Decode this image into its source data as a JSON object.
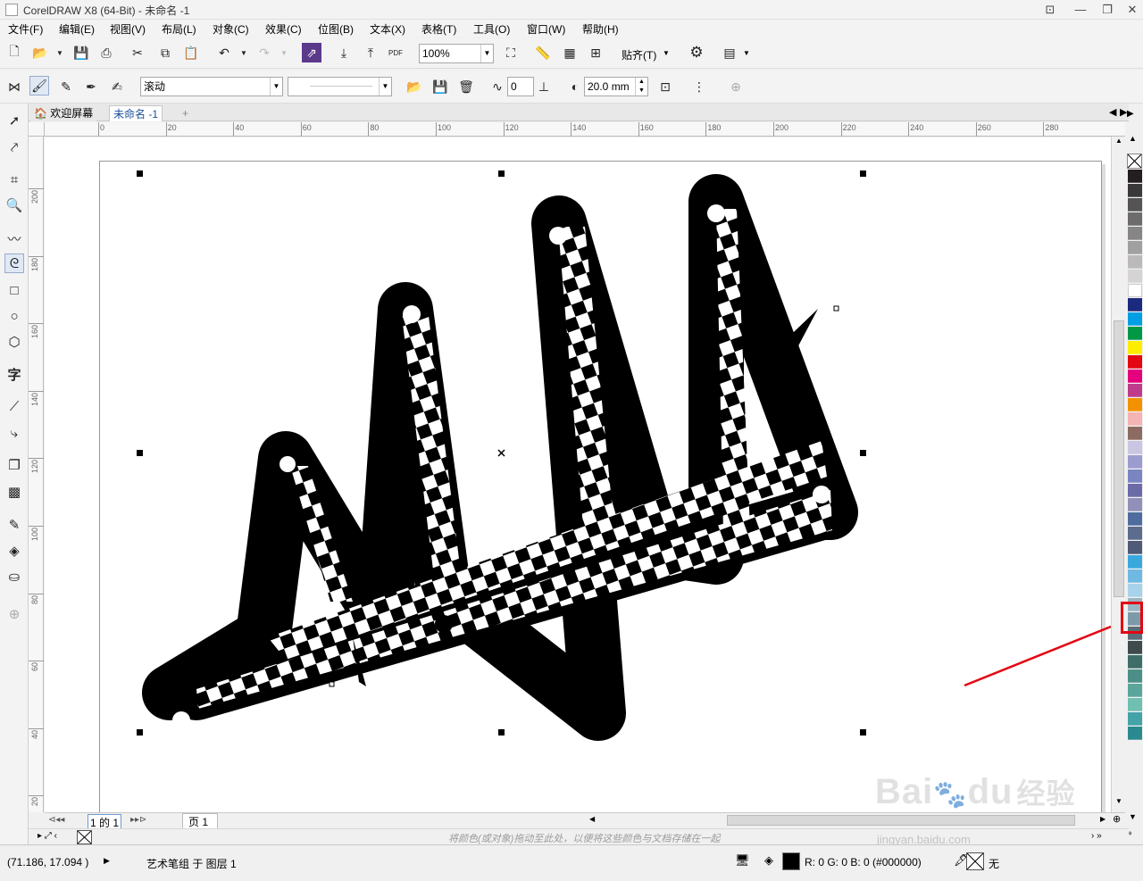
{
  "window": {
    "title": "CorelDRAW X8 (64-Bit) - 未命名 -1"
  },
  "menu": [
    "文件(F)",
    "编辑(E)",
    "视图(V)",
    "布局(L)",
    "对象(C)",
    "效果(C)",
    "位图(B)",
    "文本(X)",
    "表格(T)",
    "工具(O)",
    "窗口(W)",
    "帮助(H)"
  ],
  "standard_toolbar": {
    "zoom": "100%",
    "snap_label": "贴齐(T)",
    "pdf_label": "PDF"
  },
  "property_bar": {
    "brush_type": "滚动",
    "stroke_preset": "",
    "smoothing": "0",
    "width": "20.0 mm"
  },
  "tabs": {
    "welcome": "欢迎屏幕",
    "document": "未命名 -1"
  },
  "ruler": {
    "h_ticks": [
      "0",
      "20",
      "40",
      "60",
      "80",
      "100",
      "120",
      "140",
      "160",
      "180",
      "200",
      "220",
      "240",
      "260",
      "280"
    ],
    "v_ticks": [
      "200",
      "180",
      "160",
      "140",
      "120",
      "100",
      "80",
      "60",
      "40",
      "20"
    ]
  },
  "page_nav": {
    "current": "1",
    "of": "的",
    "total": "1",
    "page_tab": "页 1"
  },
  "doc_palette_hint": "将颜色(或对象)拖动至此处，以便将这些颜色与文档存储在一起",
  "status": {
    "coords": "(71.186, 17.094 )",
    "object_info": "艺术笔组 于 图层 1",
    "fill_info": "R: 0 G: 0 B: 0 (#000000)",
    "outline_info": "无"
  },
  "watermark": {
    "line1": "Bai",
    "line2": "du",
    "line3": "经验",
    "url": "jingyan.baidu.com"
  },
  "palette": {
    "colors": [
      "#231f20",
      "#3a3839",
      "#555354",
      "#6d6b6c",
      "#878586",
      "#a19fa0",
      "#bbb9ba",
      "#d5d3d4",
      "#ffffff",
      "#1b2a7e",
      "#009fe3",
      "#009846",
      "#ffed00",
      "#e30613",
      "#e5007e",
      "#be3c8b",
      "#f39200",
      "#f4b4b4",
      "#8c6c62",
      "#c9c6e3",
      "#9c9ccf",
      "#7b85c1",
      "#6b6ba8",
      "#9190b9",
      "#4f6c9e",
      "#5c6c8c",
      "#4e5a76",
      "#39a9dc",
      "#6fb9e2",
      "#a8d2ea",
      "#9bb4c2",
      "#7c9aa8",
      "#5a6e78",
      "#3e4a4e",
      "#3f6e69",
      "#4b8f86",
      "#5aa69b",
      "#6fbfb2",
      "#44a3a6",
      "#2b8a8f"
    ],
    "highlighted_index": 27,
    "highlight_color": "#e30613"
  },
  "annotation": {
    "arrow_color": "#e30613"
  }
}
